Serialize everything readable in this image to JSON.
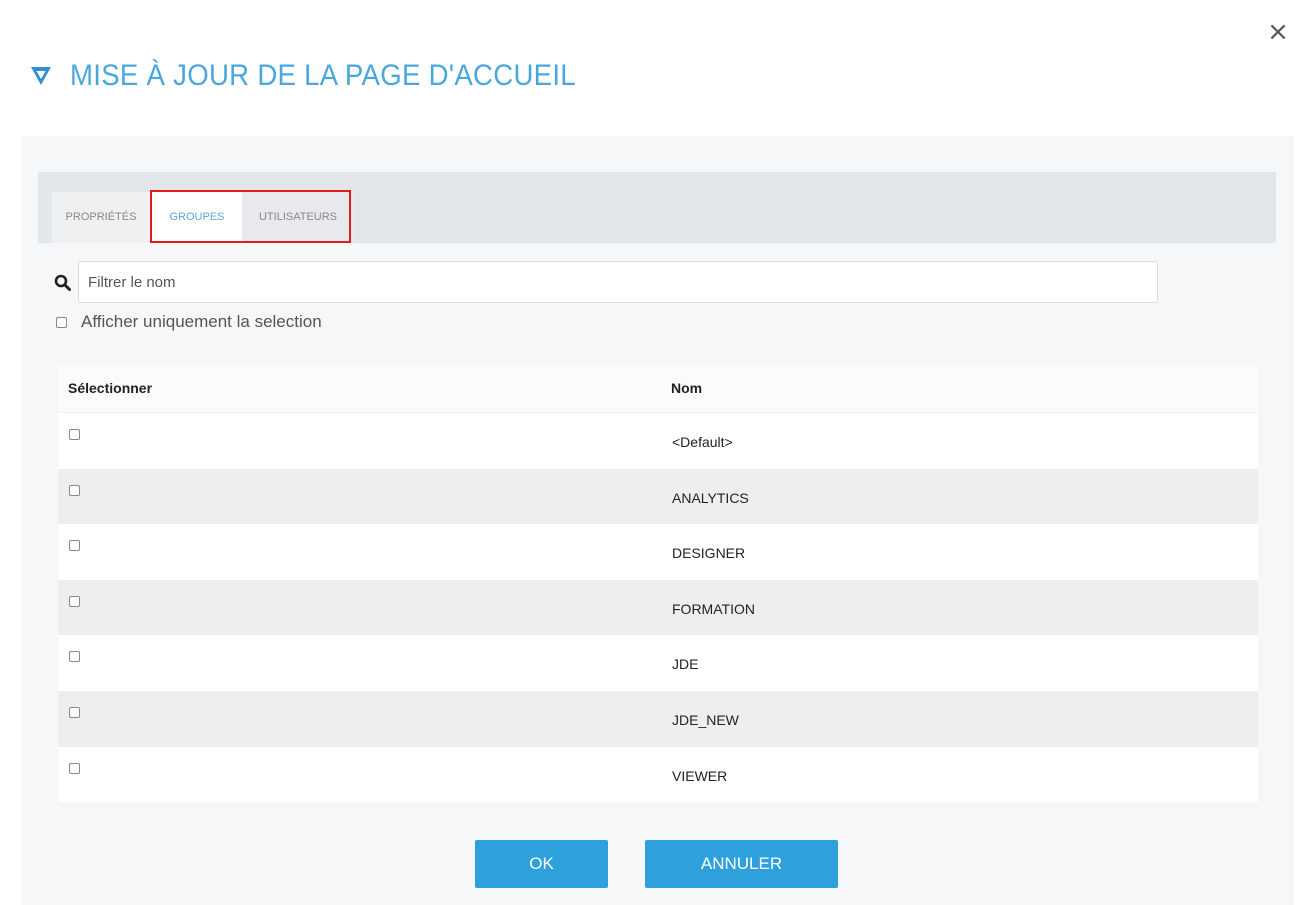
{
  "dialog": {
    "title": "MISE À JOUR DE LA PAGE D'ACCUEIL",
    "close_label": "×",
    "accent_color": "#4aa7dc"
  },
  "tabs": [
    {
      "label": "PROPRIÉTÉS",
      "active": false
    },
    {
      "label": "GROUPES",
      "active": true
    },
    {
      "label": "UTILISATEURS",
      "active": false
    }
  ],
  "search": {
    "placeholder": "Filtrer le nom",
    "value": "",
    "icon": "search-icon"
  },
  "show_selection_only": {
    "label": "Afficher uniquement la selection",
    "checked": false
  },
  "table": {
    "headers": {
      "select": "Sélectionner",
      "name": "Nom"
    },
    "rows": [
      {
        "name": "<Default>",
        "checked": false
      },
      {
        "name": "ANALYTICS",
        "checked": false
      },
      {
        "name": "DESIGNER",
        "checked": false
      },
      {
        "name": "FORMATION",
        "checked": false
      },
      {
        "name": "JDE",
        "checked": false
      },
      {
        "name": "JDE_NEW",
        "checked": false
      },
      {
        "name": "VIEWER",
        "checked": false
      }
    ]
  },
  "buttons": {
    "ok": "OK",
    "cancel": "ANNULER",
    "color": "#2ea1dc"
  }
}
